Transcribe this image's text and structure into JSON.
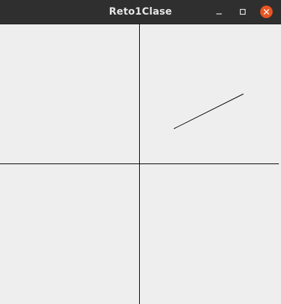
{
  "window": {
    "title": "Reto1Clase",
    "background_color": "#eeeeee",
    "titlebar_color": "#2f2f2f",
    "close_button_color": "#e95420",
    "controls": [
      {
        "icon": "minimize-icon"
      },
      {
        "icon": "maximize-icon"
      },
      {
        "icon": "close-icon"
      }
    ]
  }
}
